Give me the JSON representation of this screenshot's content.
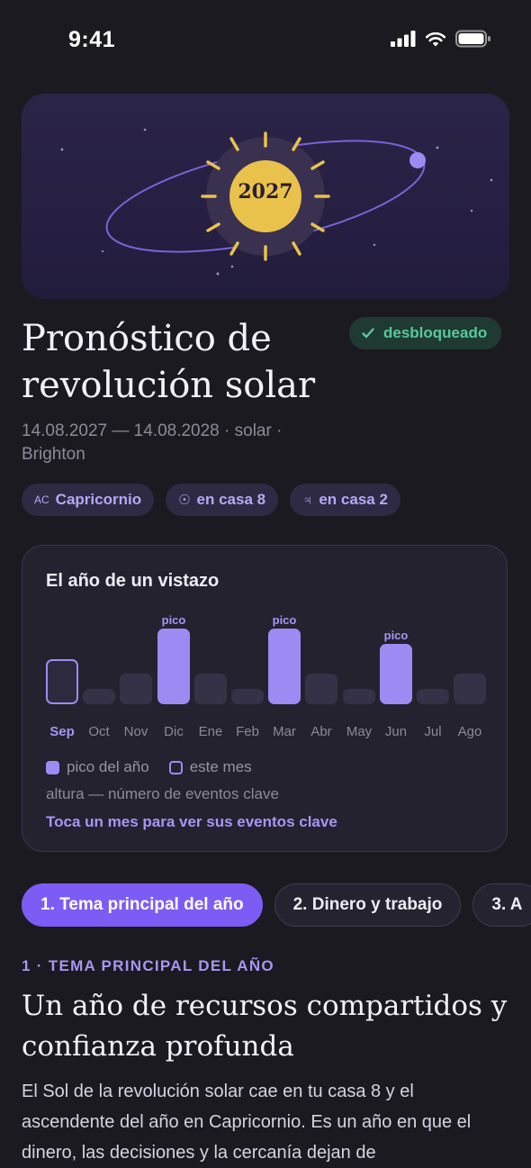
{
  "status_bar": {
    "time": "9:41"
  },
  "hero": {
    "year": "2027"
  },
  "header": {
    "title": "Pronóstico de revolución solar",
    "badge": "desbloqueado",
    "dates": "14.08.2027 — 14.08.2028 · solar · Brighton"
  },
  "chips": [
    {
      "symbol": "AC",
      "label": "Capricornio"
    },
    {
      "symbol": "☉",
      "label": "en casa 8"
    },
    {
      "symbol": "♃",
      "label": "en casa 2"
    }
  ],
  "glance": {
    "title": "El año de un vistazo",
    "peak_label": "pico",
    "months": [
      "Sep",
      "Oct",
      "Nov",
      "Dic",
      "Ene",
      "Feb",
      "Mar",
      "Abr",
      "May",
      "Jun",
      "Jul",
      "Ago"
    ],
    "current_month": "Sep",
    "legend": {
      "peak": "pico del año",
      "current": "este mes"
    },
    "note": "altura — número de eventos clave",
    "link": "Toca un mes para ver sus eventos clave"
  },
  "chart_data": {
    "type": "bar",
    "categories": [
      "Sep",
      "Oct",
      "Nov",
      "Dic",
      "Ene",
      "Feb",
      "Mar",
      "Abr",
      "May",
      "Jun",
      "Jul",
      "Ago"
    ],
    "values": [
      3,
      1,
      2,
      5,
      2,
      1,
      5,
      2,
      1,
      4,
      1,
      2
    ],
    "peaks": [
      "Dic",
      "Mar",
      "Jun"
    ],
    "highlight": "Sep"
  },
  "tabs": [
    "1. Tema principal del año",
    "2. Dinero y trabajo",
    "3. A"
  ],
  "section": {
    "label": "1 · TEMA PRINCIPAL DEL AÑO",
    "title": "Un año de recursos compartidos y confianza profunda",
    "body": "El Sol de la revolución solar cae en tu casa 8 y el ascendente del año en Capricornio. Es un año en que el dinero, las decisiones y la cercanía dejan de"
  },
  "colors": {
    "accent": "#7c5cf4",
    "peak": "#9d8bf3",
    "success": "#58c99a",
    "sun": "#e9c24b"
  }
}
